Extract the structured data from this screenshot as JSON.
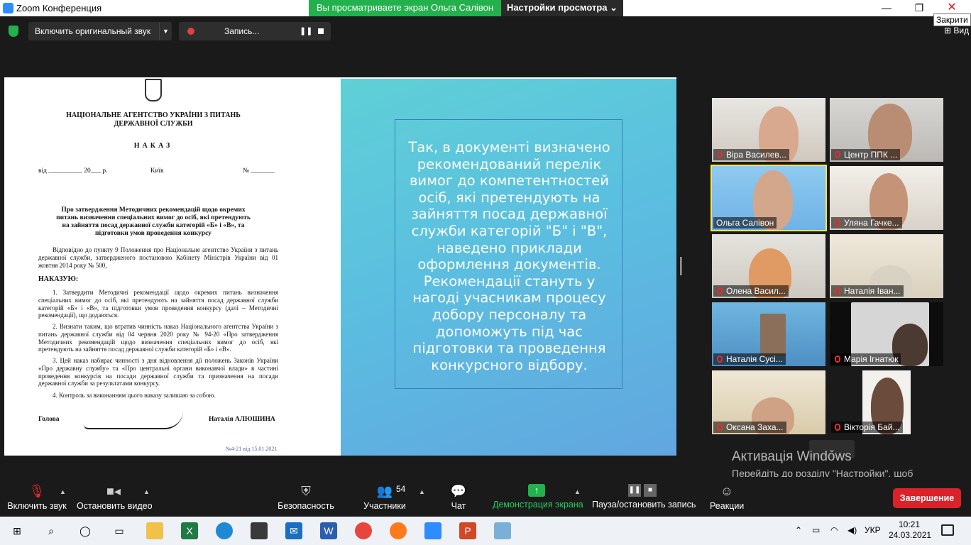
{
  "window": {
    "title": "Zoom Конференция",
    "share_banner": "Вы просматриваете экран Ольга Салівон",
    "view_settings": "Настройки просмотра",
    "close_tooltip": "Закрити",
    "view_label": "Вид"
  },
  "top_controls": {
    "audio_label": "Включить оригинальный звук",
    "record_label": "Запись..."
  },
  "document": {
    "agency": "НАЦІОНАЛЬНЕ АГЕНТСТВО УКРАЇНИ З ПИТАНЬ ДЕРЖАВНОЇ СЛУЖБИ",
    "title": "НАКАЗ",
    "date_field": "від __________ 20___ р.",
    "city": "Київ",
    "number_field": "№ _______",
    "subject": "Про затвердження Методичних рекомендацій щодо окремих питань визначення спеціальних вимог до осіб, які претендують на зайняття посад державної служби категорій «Б» і «В», та підготовки умов проведення конкурсу",
    "preamble": "Відповідно до пункту 9 Положення про Національне агентство України з питань державної служби, затвердженого постановою Кабінету Міністрів України від 01 жовтня 2014 року № 500,",
    "order_word": "НАКАЗУЮ:",
    "item1": "1. Затвердити Методичні рекомендації щодо окремих питань визначення спеціальних вимог до осіб, які претендують на зайняття посад державної служби категорій «Б» і «В», та підготовки умов проведення конкурсу (далі – Методичні рекомендації), що додаються.",
    "item2": "2. Визнати таким, що втратив чинність наказ Національного агентства України з питань державної служби від 04 червня 2020 року № 94-20 «Про затвердження Методичних рекомендацій щодо визначення спеціальних вимог до осіб, які претендують на зайняття посад державної служби категорій «Б» і «В».",
    "item3": "3. Цей наказ набирає чинності з дня відновлення дії положень Законів України «Про державну службу» та «Про центральні органи виконавчої влади» в частині проведення конкурсів на посади державної служби та призначення на посади державної служби за результатами конкурсу.",
    "item4": "4. Контроль за виконанням цього наказу залишаю за собою.",
    "head_title": "Голова",
    "head_name": "Наталія АЛЮШИНА",
    "reg_no": "№4-21 від 15.01.2021"
  },
  "slide": {
    "text": "Так, в документі визначено рекомендований перелік вимог до компетентностей осіб, які претендують на зайняття посад державної служби категорій \"Б\" і \"В\", наведено приклади оформлення документів. Рекомендації стануть у нагоді учасникам процесу добору персоналу та допоможуть під час підготовки та проведення конкурсного відбору."
  },
  "participants": [
    {
      "name": "Віра Василев...",
      "muted": true
    },
    {
      "name": "Центр ППК ...",
      "muted": true
    },
    {
      "name": "Ольга Салівон",
      "muted": false,
      "active": true
    },
    {
      "name": "Уляна Гачке...",
      "muted": true
    },
    {
      "name": "Олена Васил...",
      "muted": true
    },
    {
      "name": "Наталія Іван...",
      "muted": true
    },
    {
      "name": "Наталія Сусі...",
      "muted": true
    },
    {
      "name": "Марія Ігнатюк",
      "muted": true
    },
    {
      "name": "Оксана Заха...",
      "muted": true
    },
    {
      "name": "Вікторія Бай...",
      "muted": true
    }
  ],
  "activation": {
    "title": "Активація Windows",
    "subtitle": "Перейдіть до розділу \"Настройки\", щоб активувати Windows."
  },
  "toolbar": {
    "unmute": "Включить звук",
    "stop_video": "Остановить видео",
    "security": "Безопасность",
    "participants": "Участники",
    "participants_count": "54",
    "chat": "Чат",
    "share": "Демонстрация экрана",
    "pause_record": "Пауза/остановить запись",
    "reactions": "Реакции",
    "end": "Завершение"
  },
  "taskbar": {
    "language": "УКР",
    "time": "10:21",
    "date": "24.03.2021"
  },
  "colors": {
    "zoom_green": "#23b14d",
    "end_red": "#d9222a",
    "active_speaker": "#f6e64a",
    "muted_mic": "#e02e2e"
  }
}
